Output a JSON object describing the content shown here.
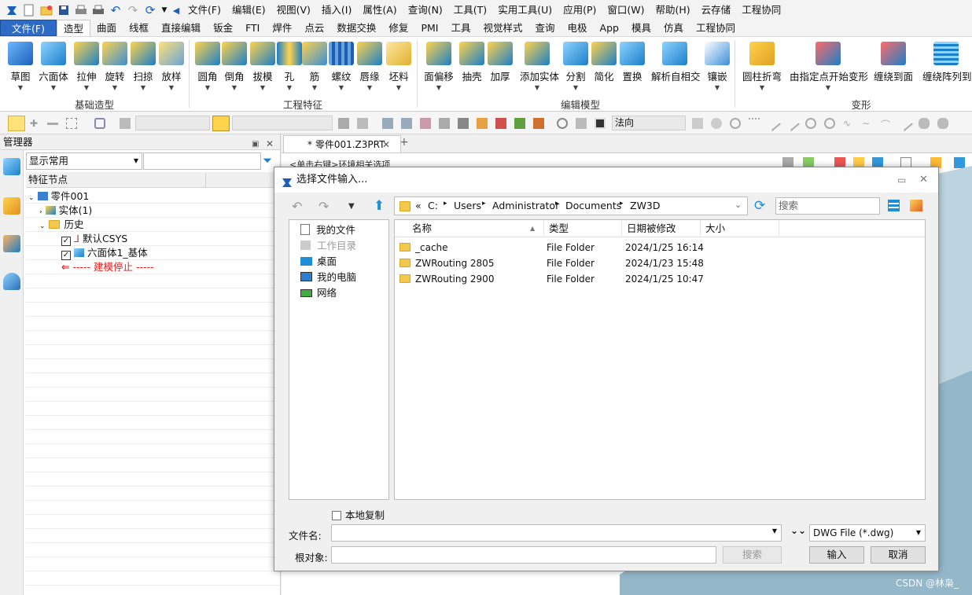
{
  "menu": [
    "文件(F)",
    "编辑(E)",
    "视图(V)",
    "插入(I)",
    "属性(A)",
    "查询(N)",
    "工具(T)",
    "实用工具(U)",
    "应用(P)",
    "窗口(W)",
    "帮助(H)",
    "云存储",
    "工程协同"
  ],
  "ribbon_tabs": [
    "文件(F)",
    "造型",
    "曲面",
    "线框",
    "直接编辑",
    "钣金",
    "FTI",
    "焊件",
    "点云",
    "数据交换",
    "修复",
    "PMI",
    "工具",
    "视觉样式",
    "查询",
    "电极",
    "App",
    "模具",
    "仿真",
    "工程协同"
  ],
  "ribbon_active": "造型",
  "ribbon_buttons": [
    "草图",
    "六面体",
    "拉伸",
    "旋转",
    "扫掠",
    "放样",
    "圆角",
    "倒角",
    "拔模",
    "孔",
    "筋",
    "螺纹",
    "唇缘",
    "坯料",
    "面偏移",
    "抽壳",
    "加厚",
    "添加实体",
    "分割",
    "简化",
    "置换",
    "解析自相交",
    "镶嵌",
    "圆柱折弯",
    "由指定点开始变形",
    "缠绕到面",
    "缠绕阵列到面"
  ],
  "ribbon_groups": [
    "基础造型",
    "工程特征",
    "编辑模型",
    "变形"
  ],
  "toolbar2": {
    "normal_label": "法向"
  },
  "manager": {
    "title": "管理器",
    "filter_value": "显示常用",
    "column": "特征节点",
    "tree": [
      "零件001",
      "实体(1)",
      "历史",
      "默认CSYS",
      "六面体1_基体",
      "----- 建模停止 -----"
    ]
  },
  "doc": {
    "tab": "* 零件001.Z3PRT",
    "hint": "<单击右键>环境相关选项"
  },
  "dialog": {
    "title": "选择文件输入...",
    "path": [
      "C:",
      "Users",
      "Administrator",
      "Documents",
      "ZW3D"
    ],
    "search_placeholder": "搜索",
    "places": [
      "我的文件",
      "工作目录",
      "桌面",
      "我的电脑",
      "网络"
    ],
    "columns": [
      "名称",
      "类型",
      "日期被修改",
      "大小"
    ],
    "files": [
      {
        "name": "_cache",
        "type": "File Folder",
        "date": "2024/1/25 16:14",
        "size": ""
      },
      {
        "name": "ZWRouting 2805",
        "type": "File Folder",
        "date": "2024/1/23 15:48",
        "size": ""
      },
      {
        "name": "ZWRouting 2900",
        "type": "File Folder",
        "date": "2024/1/25 10:47",
        "size": ""
      }
    ],
    "local_copy": "本地复制",
    "filename_label": "文件名:",
    "filename_value": "",
    "root_label": "根对象:",
    "search_button": "搜索",
    "filter": "DWG File (*.dwg)",
    "ok": "输入",
    "cancel": "取消"
  },
  "watermark": "CSDN @林枭_",
  "colors": {
    "accent": "#2d6bc4",
    "folder": "#f2c94c",
    "stop": "#e02020"
  }
}
